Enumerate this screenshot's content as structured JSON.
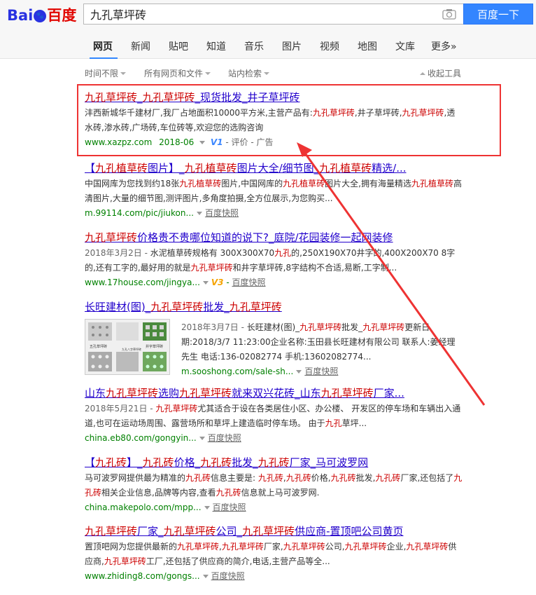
{
  "logo": {
    "text_bai": "Bai",
    "text_du": "du",
    "text_cn": "百度"
  },
  "search": {
    "query": "九孔草坪砖",
    "button_label": "百度一下",
    "camera_icon": "camera-icon"
  },
  "tabs": [
    {
      "label": "网页",
      "active": true
    },
    {
      "label": "新闻"
    },
    {
      "label": "贴吧"
    },
    {
      "label": "知道"
    },
    {
      "label": "音乐"
    },
    {
      "label": "图片"
    },
    {
      "label": "视频"
    },
    {
      "label": "地图"
    },
    {
      "label": "文库"
    },
    {
      "label": "更多»"
    }
  ],
  "tools": {
    "time": "时间不限",
    "type": "所有网页和文件",
    "site": "站内检索",
    "collapse": "收起工具"
  },
  "results": [
    {
      "title": "九孔草坪砖_九孔草坪砖_现货批发_井子草坪砖",
      "abstract": "沣西新城华千建材厂,我厂占地面积10000平方米,主营产品有:九孔草坪砖,井子草坪砖,九孔草坪砖,透水砖,渗水砖,广场砖,车位砖等,欢迎您的选购咨询",
      "url": "www.xazpz.com",
      "date": "2018-06",
      "badge": "V1",
      "extra": "- 评价 - 广告"
    },
    {
      "title": "【九孔植草砖图片】_九孔植草砖图片大全/细节图_九孔植草砖精选/...",
      "abstract": "中国网库为您找到约18张九孔植草砖图片,中国网库的九孔植草砖图片大全,拥有海量精选九孔植草砖高清图片,大量的细节图,测评图片,多角度拍摄,全方位展示,为您购买...",
      "url": "m.99114.com/pic/jiukon...",
      "snap": "百度快照"
    },
    {
      "title": "九孔草坪砖价格贵不贵哪位知道的说下?_庭院/花园装修一起网装修",
      "date_prefix": "2018年3月2日 - ",
      "abstract": "水泥植草砖规格有 300X300X70九孔的,250X190X70井字的,400X200X70 8字的,还有工字的,最好用的就是九孔草坪砖和井字草坪砖,8字结构不合适,易断,工字制...",
      "url": "www.17house.com/jingya...",
      "badge": "V3",
      "snap": "百度快照"
    },
    {
      "title": "长旺建材(图)_九孔草坪砖批发_九孔草坪砖",
      "date_prefix": "2018年3月7日 - ",
      "abstract": "长旺建材(图)_九孔草坪砖批发_九孔草坪砖更新日期:2018/3/7 11:23:00企业名称:玉田县长旺建材有限公司 联系人:姜经理先生 电话:136-02082774 手机:13602082774...",
      "url": "m.sooshong.com/sale-sh...",
      "snap": "百度快照"
    },
    {
      "title": "山东九孔草坪砖选购九孔草坪砖就来双兴花砖_山东九孔草坪砖厂家...",
      "date_prefix": "2018年5月21日 - ",
      "abstract": "九孔草坪砖尤其适合于设在各类居住小区、办公楼、 开发区的停车场和车辆出入通道,也可在运动场周围、露营场所和草坪上建造临时停车场。 由于九孔草坪...",
      "url": "china.eb80.com/gongyin...",
      "snap": "百度快照"
    },
    {
      "title": "【九孔砖】_九孔砖价格_九孔砖批发_九孔砖厂家_马可波罗网",
      "abstract": "马可波罗网提供最为精准的九孔砖信息主要是: 九孔砖,九孔砖价格,九孔砖批发,九孔砖厂家,还包括了九孔砖相关企业信息,品牌等内容,查看九孔砖信息就上马可波罗网.",
      "url": "china.makepolo.com/mpp...",
      "snap": "百度快照"
    },
    {
      "title": "九孔草坪砖厂家_九孔草坪砖公司_九孔草坪砖供应商-置顶吧公司黄页",
      "abstract": "置顶吧网为您提供最新的九孔草坪砖,九孔草坪砖厂家,九孔草坪砖公司,九孔草坪砖企业,九孔草坪砖供应商,九孔草坪砖工厂,还包括了供应商的简介,电话,主营产品等全...",
      "url": "www.zhiding8.com/gongs...",
      "snap": "百度快照"
    }
  ],
  "thumbnail": {
    "caption_left": "五孔草坪砖",
    "caption_right": "井字草坪砖",
    "caption_bottom": "九孔八字草坪砖"
  },
  "colors": {
    "highlight_box": "#e33333",
    "link": "#2100cc",
    "keyword": "#cc0000",
    "url": "#008000",
    "search_button": "#3385ff"
  }
}
